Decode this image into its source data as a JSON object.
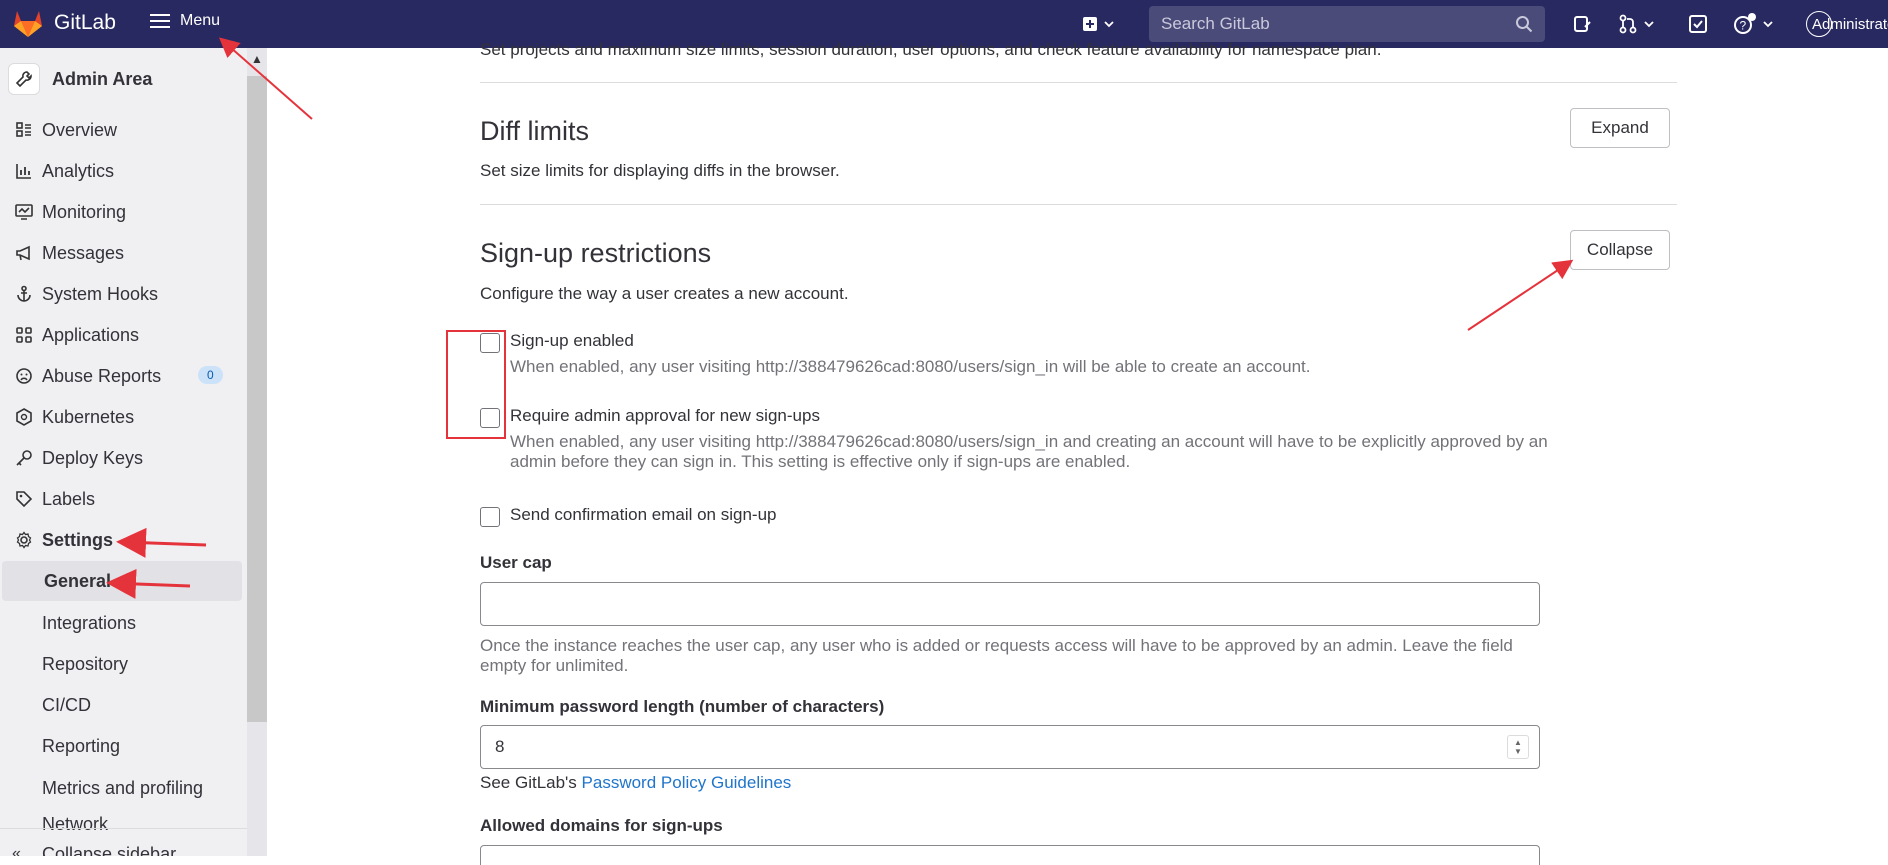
{
  "topbar": {
    "logo_text": "GitLab",
    "menu_label": "Menu",
    "search_placeholder": "Search GitLab",
    "user_name": "Administrator",
    "icons": [
      "plus-square-icon",
      "chevron-down-icon",
      "search-icon",
      "issues-icon",
      "merge-request-icon",
      "todo-icon",
      "help-icon"
    ]
  },
  "sidebar": {
    "header": "Admin Area",
    "items": [
      {
        "label": "Overview",
        "icon": "overview-icon"
      },
      {
        "label": "Analytics",
        "icon": "analytics-icon"
      },
      {
        "label": "Monitoring",
        "icon": "monitor-icon"
      },
      {
        "label": "Messages",
        "icon": "megaphone-icon"
      },
      {
        "label": "System Hooks",
        "icon": "anchor-icon"
      },
      {
        "label": "Applications",
        "icon": "apps-icon"
      },
      {
        "label": "Abuse Reports",
        "icon": "abuse-icon",
        "badge": "0"
      },
      {
        "label": "Kubernetes",
        "icon": "kubernetes-icon"
      },
      {
        "label": "Deploy Keys",
        "icon": "key-icon"
      },
      {
        "label": "Labels",
        "icon": "label-icon"
      },
      {
        "label": "Settings",
        "icon": "settings-icon"
      }
    ],
    "sub_items": [
      "General",
      "Integrations",
      "Repository",
      "CI/CD",
      "Reporting",
      "Metrics and profiling",
      "Network",
      "Collapse sidebar"
    ]
  },
  "content": {
    "cut_text": "Set projects and maximum size limits, session duration, user options, and check feature availability for namespace plan.",
    "diff": {
      "title": "Diff limits",
      "desc": "Set size limits for displaying diffs in the browser.",
      "button": "Expand"
    },
    "signup": {
      "title": "Sign-up restrictions",
      "desc": "Configure the way a user creates a new account.",
      "button": "Collapse",
      "signup_enabled_label": "Sign-up enabled",
      "signup_enabled_help": "When enabled, any user visiting http://388479626cad:8080/users/sign_in will be able to create an account.",
      "admin_approval_label": "Require admin approval for new sign-ups",
      "admin_approval_help": "When enabled, any user visiting http://388479626cad:8080/users/sign_in and creating an account will have to be explicitly approved by an admin before they can sign in. This setting is effective only if sign-ups are enabled.",
      "confirm_email_label": "Send confirmation email on sign-up",
      "user_cap_label": "User cap",
      "user_cap_value": "",
      "user_cap_help": "Once the instance reaches the user cap, any user who is added or requests access will have to be approved by an admin. Leave the field empty for unlimited.",
      "min_pw_label": "Minimum password length (number of characters)",
      "min_pw_value": "8",
      "pw_see_prefix": "See GitLab's ",
      "pw_link": "Password Policy Guidelines",
      "allowed_domains_label": "Allowed domains for sign-ups"
    }
  },
  "colors": {
    "navbar": "#292961",
    "sidebar": "#f0f0f3",
    "annotation": "#e5333c",
    "link": "#1f75cb"
  }
}
